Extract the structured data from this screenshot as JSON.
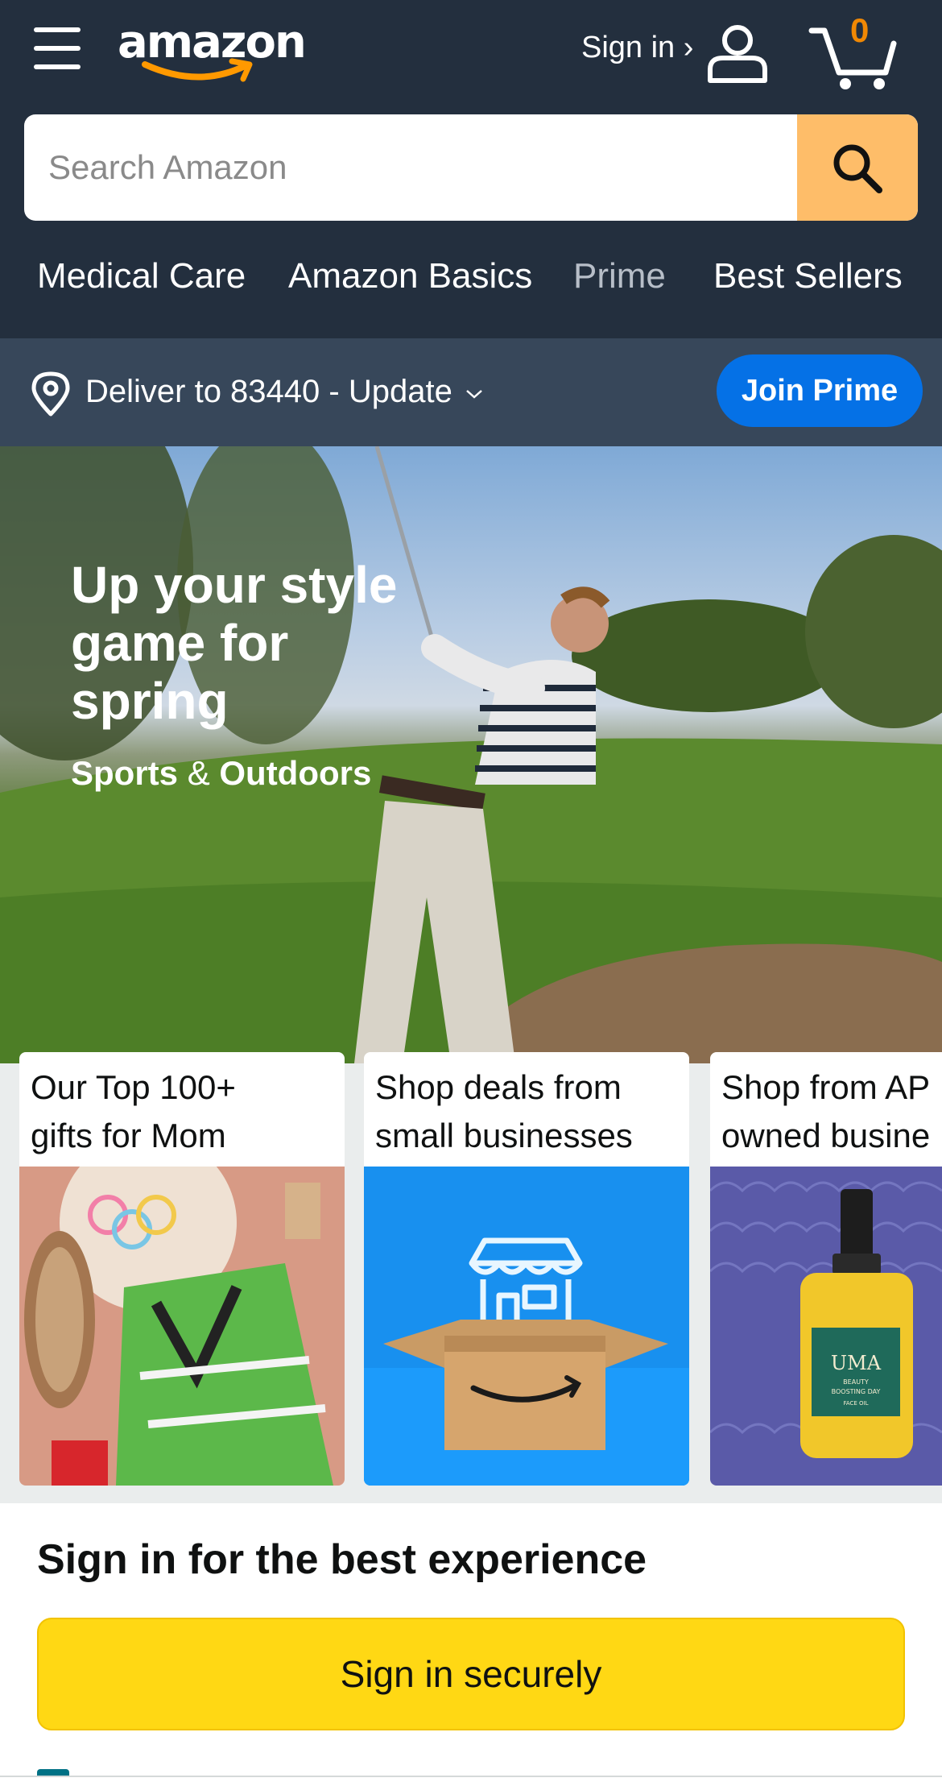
{
  "header": {
    "logo_text": "amazon",
    "signin_label": "Sign in ›",
    "cart_count": "0",
    "icons": [
      "menu-icon",
      "user-icon",
      "cart-icon",
      "search-icon"
    ]
  },
  "search": {
    "placeholder": "Search Amazon",
    "value": ""
  },
  "nav": {
    "links": [
      {
        "label": "Medical Care"
      },
      {
        "label": "Amazon Basics"
      },
      {
        "label": "Prime"
      },
      {
        "label": "Best Sellers"
      }
    ]
  },
  "deliver": {
    "text": "Deliver to 83440 - Update",
    "join_prime_label": "Join Prime"
  },
  "hero": {
    "headline": "Up your style game for spring",
    "sub_left": "Sports",
    "sub_amp": "&",
    "sub_right": "Outdoors"
  },
  "cards": [
    {
      "title": "Our Top 100+\ngifts for Mom"
    },
    {
      "title": "Shop deals from\nsmall businesses"
    },
    {
      "title": "Shop from AP\nowned busine"
    }
  ],
  "card_image_labels": {
    "uma_brand": "UMA",
    "uma_line1": "BEAUTY",
    "uma_line2": "BOOSTING DAY",
    "uma_line3": "FACE OIL"
  },
  "signin_panel": {
    "title": "Sign in for the best experience",
    "button_label": "Sign in securely"
  },
  "colors": {
    "header_bg": "#232f3e",
    "deliver_bg": "#37475a",
    "search_button": "#febd69",
    "join_prime": "#0571e6",
    "cart_count": "#f08804",
    "signin_button": "#ffd814",
    "logo_smile": "#ff9900"
  }
}
